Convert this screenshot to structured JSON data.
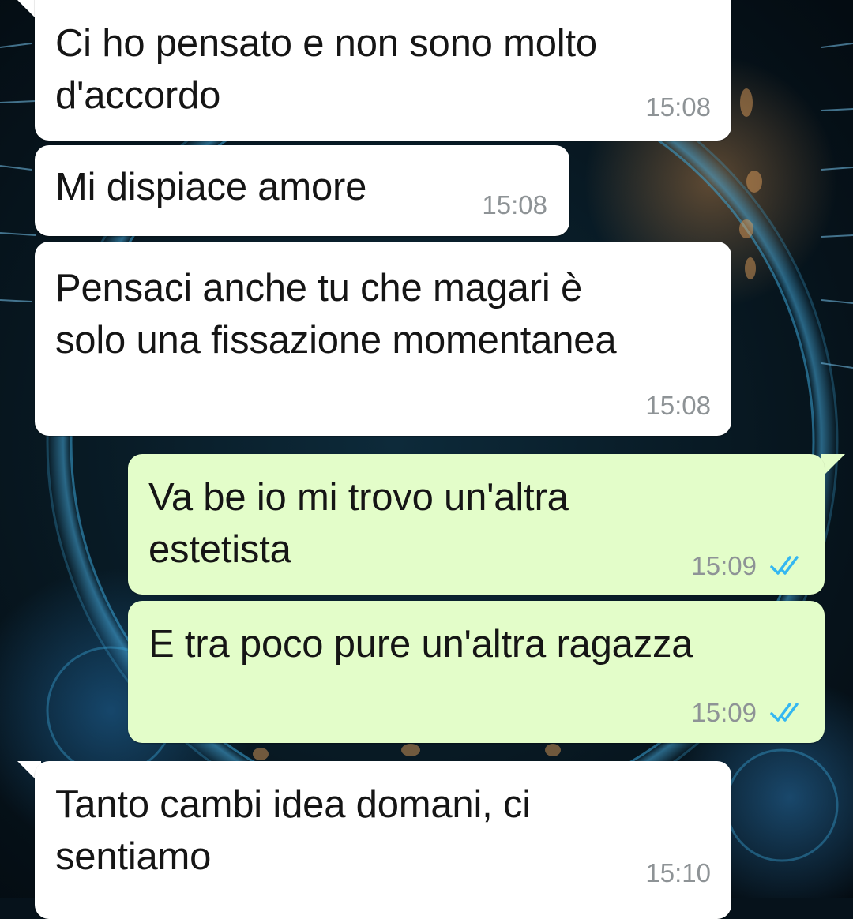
{
  "messages": [
    {
      "direction": "incoming",
      "text": "Ci ho pensato e non sono molto\nd'accordo",
      "time": "15:08"
    },
    {
      "direction": "incoming",
      "text": "Mi dispiace amore",
      "time": "15:08"
    },
    {
      "direction": "incoming",
      "text": "Pensaci anche tu che magari è\nsolo una fissazione momentanea",
      "time": "15:08"
    },
    {
      "direction": "outgoing",
      "text": "Va be io mi trovo un'altra\nestetista",
      "time": "15:09",
      "status": "read"
    },
    {
      "direction": "outgoing",
      "text": "E tra poco pure un'altra ragazza",
      "time": "15:09",
      "status": "read"
    },
    {
      "direction": "incoming",
      "text": "Tanto cambi idea domani, ci\nsentiamo",
      "time": "15:10"
    }
  ],
  "colors": {
    "incoming_bubble": "#ffffff",
    "outgoing_bubble": "#e3fdc9",
    "read_ticks": "#34b7f1",
    "time_text": "#8e9396"
  },
  "icons": {
    "read_status": "double-check-icon"
  }
}
